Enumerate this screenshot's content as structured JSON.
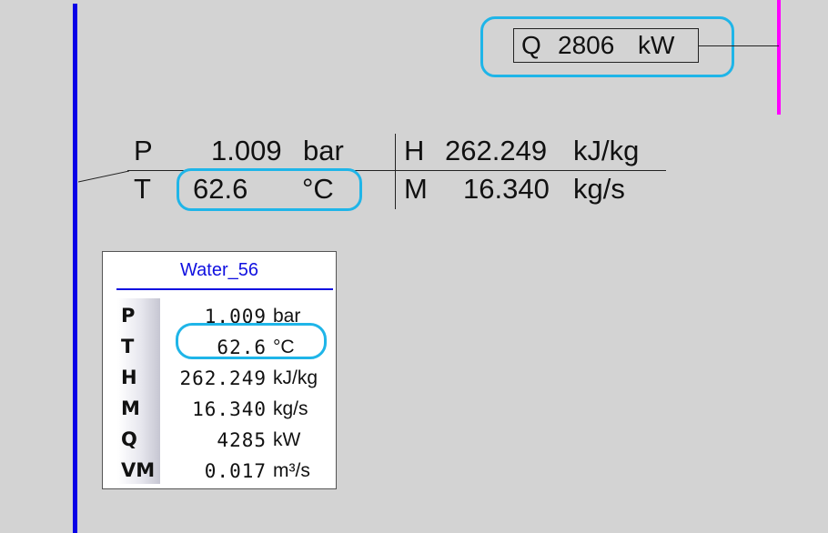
{
  "heat_stream": {
    "label": "Q",
    "value": "2806",
    "unit": "kW"
  },
  "stream_summary": {
    "pressure": {
      "label": "P",
      "value": "1.009",
      "unit": "bar"
    },
    "temperature": {
      "label": "T",
      "value": "62.6",
      "unit": "°C"
    },
    "enthalpy": {
      "label": "H",
      "value": "262.249",
      "unit": "kJ/kg"
    },
    "mass_flow": {
      "label": "M",
      "value": "16.340",
      "unit": "kg/s"
    }
  },
  "stream_panel": {
    "title": "Water_56",
    "rows": [
      {
        "label": "P",
        "value": "1.009",
        "unit": "bar"
      },
      {
        "label": "T",
        "value": "62.6",
        "unit": "°C"
      },
      {
        "label": "H",
        "value": "262.249",
        "unit": "kJ/kg"
      },
      {
        "label": "M",
        "value": "16.340",
        "unit": "kg/s"
      },
      {
        "label": "Q",
        "value": "4285",
        "unit": "kW"
      },
      {
        "label": "VM",
        "value": "0.017",
        "unit": "m³/s"
      }
    ]
  },
  "colors": {
    "background": "#d3d3d3",
    "water_pipe": "#0a00e6",
    "heat_line": "#ff00ff",
    "highlight": "#1fb5e8",
    "panel_title": "#1010e0"
  }
}
